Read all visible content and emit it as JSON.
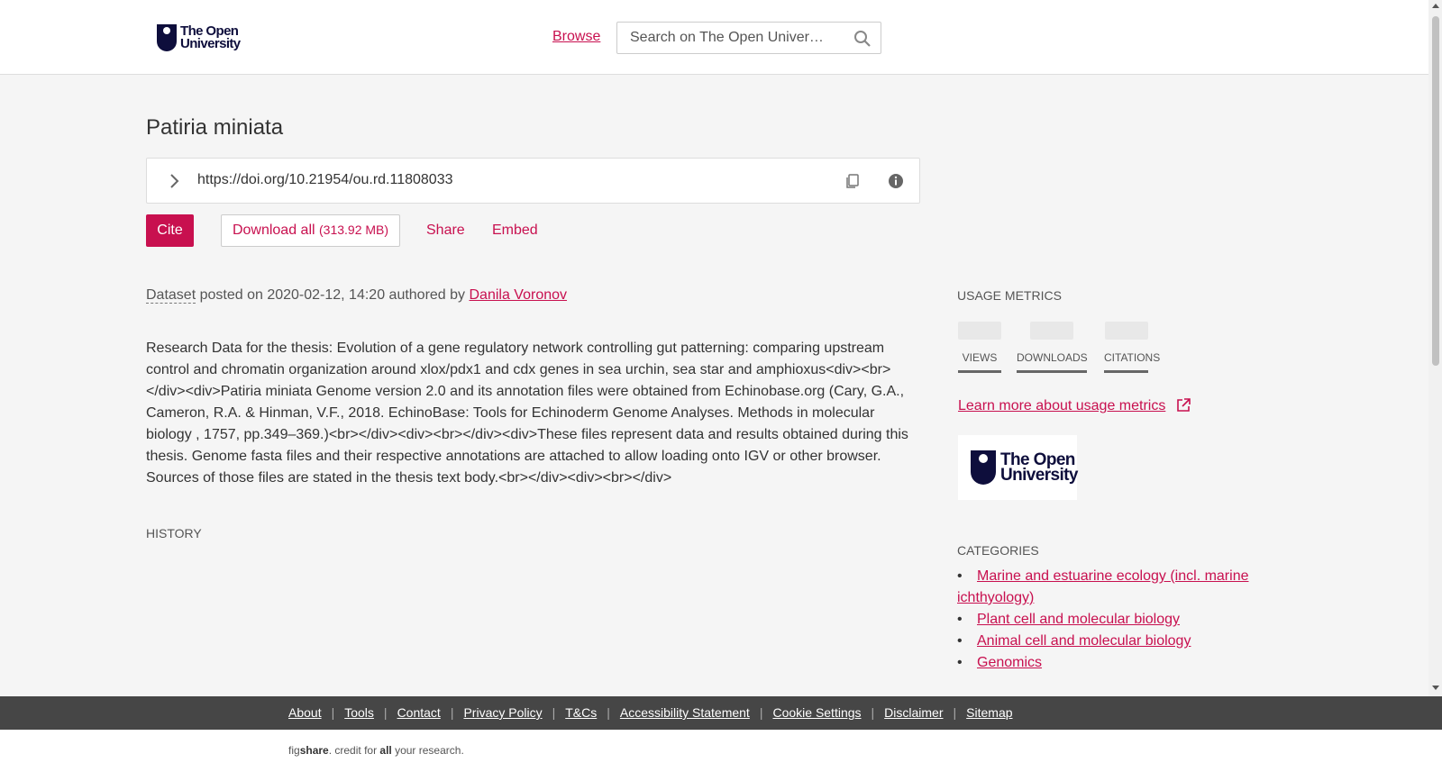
{
  "header": {
    "logo_text_line1": "The Open",
    "logo_text_line2": "University",
    "browse_label": "Browse",
    "search_placeholder": "Search on The Open Univer…"
  },
  "item": {
    "title": "Patiria miniata",
    "doi": "https://doi.org/10.21954/ou.rd.11808033",
    "cite_label": "Cite",
    "download_label": "Download all",
    "download_size": "(313.92 MB)",
    "share_label": "Share",
    "embed_label": "Embed",
    "type": "Dataset",
    "posted_text": "posted on 2020-02-12, 14:20 authored by",
    "author": "Danila Voronov",
    "description": "Research Data for the thesis: Evolution of a gene regulatory network controlling gut patterning: comparing upstream control and chromatin organization around xlox/pdx1 and cdx genes in sea urchin, sea star and amphioxus<div><br></div><div>Patiria miniata Genome version 2.0 and its annotation files were obtained from Echinobase.org (Cary, G.A., Cameron, R.A. & Hinman, V.F., 2018. EchinoBase: Tools for Echinoderm Genome Analyses. Methods in molecular biology , 1757, pp.349–369.)<br></div><div><br></div><div>These files represent data and results obtained during this thesis. Genome fasta files and their respective annotations are attached to allow loading onto IGV or other browser. Sources of those files are stated in the thesis text body.<br></div><div><br></div>",
    "history_label": "HISTORY"
  },
  "sidebar": {
    "metrics_heading": "USAGE METRICS",
    "metrics": [
      {
        "label": "VIEWS"
      },
      {
        "label": "DOWNLOADS"
      },
      {
        "label": "CITATIONS"
      }
    ],
    "learn_more": "Learn more about usage metrics",
    "categories_heading": "CATEGORIES",
    "categories": [
      "Marine and estuarine ecology (incl. marine ichthyology)",
      "Plant cell and molecular biology",
      "Animal cell and molecular biology",
      "Genomics"
    ]
  },
  "footer": {
    "links": [
      "About",
      "Tools",
      "Contact",
      "Privacy Policy",
      "T&Cs",
      "Accessibility Statement",
      "Cookie Settings",
      "Disclaimer",
      "Sitemap"
    ],
    "credit_pre": "fig",
    "credit_brand": "share",
    "credit_mid": ". credit for ",
    "credit_bold": "all",
    "credit_post": " your research."
  },
  "colors": {
    "accent": "#c8104f",
    "logo": "#0e0e3c",
    "footer_bg": "#464646"
  }
}
